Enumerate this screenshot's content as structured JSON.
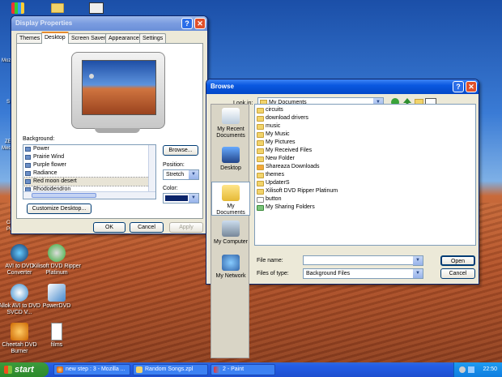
{
  "desktop": {
    "icons": [
      {
        "label": "AVI to DVD Converter"
      },
      {
        "label": "Xilisoft DVD Ripper Platinum"
      },
      {
        "label": "Allok AVI to DVD SVCD V..."
      },
      {
        "label": "PowerDVD"
      },
      {
        "label": "Cheetah DVD Burner"
      },
      {
        "label": "films"
      }
    ],
    "edge_labels": [
      "Mozi",
      "S",
      "ZE",
      "Mec",
      "Cl",
      "Pr"
    ]
  },
  "display_properties": {
    "title": "Display Properties",
    "help_glyph": "?",
    "close_glyph": "✕",
    "tabs": [
      "Themes",
      "Desktop",
      "Screen Saver",
      "Appearance",
      "Settings"
    ],
    "active_tab": "Desktop",
    "background_label": "Background:",
    "backgrounds": [
      "Power",
      "Prairie Wind",
      "Purple flower",
      "Radiance",
      "Red moon desert",
      "Rhododendron"
    ],
    "selected_background": "Red moon desert",
    "browse_button": "Browse...",
    "position_label": "Position:",
    "position_value": "Stretch",
    "color_label": "Color:",
    "customize_button": "Customize Desktop...",
    "ok_button": "OK",
    "cancel_button": "Cancel",
    "apply_button": "Apply",
    "colors": {
      "swatch": "#0a246a"
    }
  },
  "browse_dialog": {
    "title": "Browse",
    "help_glyph": "?",
    "close_glyph": "✕",
    "look_in_label": "Look in:",
    "look_in_value": "My Documents",
    "places": [
      {
        "label": "My Recent Documents"
      },
      {
        "label": "Desktop"
      },
      {
        "label": "My Documents"
      },
      {
        "label": "My Computer"
      },
      {
        "label": "My Network"
      }
    ],
    "selected_place": "My Documents",
    "files": [
      "circuits",
      "download drivers",
      "music",
      "My Music",
      "My Pictures",
      "My Received Files",
      "New Folder",
      "Shareaza Downloads",
      "themes",
      "UpdaterS",
      "Xilisoft DVD Ripper Platinum",
      "button",
      "My Sharing Folders"
    ],
    "file_name_label": "File name:",
    "file_name_value": "",
    "files_of_type_label": "Files of type:",
    "files_of_type_value": "Background Files",
    "open_button": "Open",
    "cancel_button": "Cancel"
  },
  "taskbar": {
    "start_label": "start",
    "tasks": [
      {
        "label": "new step : 3 - Mozilla ..."
      },
      {
        "label": "Random Songs.zpl"
      },
      {
        "label": "2 - Paint"
      }
    ],
    "clock": "22:50"
  }
}
